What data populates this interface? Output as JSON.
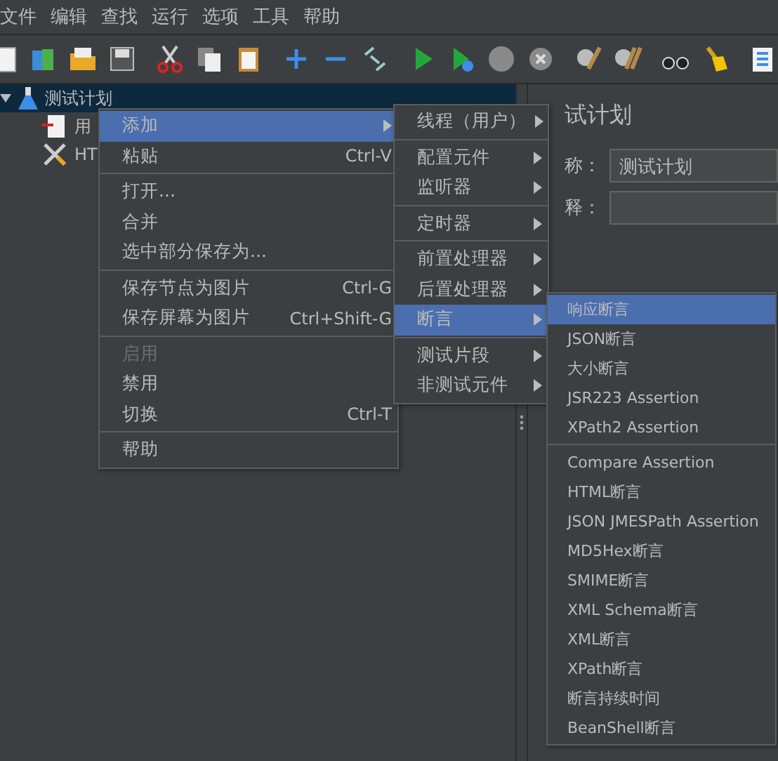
{
  "menubar": [
    "文件",
    "编辑",
    "查找",
    "运行",
    "选项",
    "工具",
    "帮助"
  ],
  "tree": [
    {
      "label": "测试计划",
      "selected": true,
      "expanded": true,
      "children": [
        {
          "label": "用",
          "kind": "thread"
        },
        {
          "label": "HT",
          "kind": "config"
        }
      ]
    }
  ],
  "right_panel": {
    "title": "试计划",
    "fields": [
      {
        "label": "称：",
        "value": "测试计划"
      },
      {
        "label": "释："
      }
    ]
  },
  "context_menu": [
    [
      {
        "label": "添加",
        "submenu": true,
        "selected": true,
        "disabled": false
      },
      {
        "label": "粘贴",
        "shortcut": "Ctrl-V",
        "submenu": false,
        "selected": false,
        "disabled": false
      }
    ],
    [
      {
        "label": "打开...",
        "submenu": false,
        "selected": false,
        "disabled": false
      },
      {
        "label": "合并",
        "submenu": false,
        "selected": false,
        "disabled": false
      },
      {
        "label": "选中部分保存为...",
        "submenu": false,
        "selected": false,
        "disabled": false
      }
    ],
    [
      {
        "label": "保存节点为图片",
        "shortcut": "Ctrl-G",
        "submenu": false,
        "selected": false,
        "disabled": false
      },
      {
        "label": "保存屏幕为图片",
        "shortcut": "Ctrl+Shift-G",
        "submenu": false,
        "selected": false,
        "disabled": false
      }
    ],
    [
      {
        "label": "启用",
        "submenu": false,
        "selected": false,
        "disabled": true
      },
      {
        "label": "禁用",
        "submenu": false,
        "selected": false,
        "disabled": false
      },
      {
        "label": "切换",
        "shortcut": "Ctrl-T",
        "submenu": false,
        "selected": false,
        "disabled": false
      }
    ],
    [
      {
        "label": "帮助",
        "submenu": false,
        "selected": false,
        "disabled": false
      }
    ]
  ],
  "add_submenu": [
    [
      {
        "label": "线程（用户）",
        "submenu": true,
        "selected": false
      }
    ],
    [
      {
        "label": "配置元件",
        "submenu": true,
        "selected": false
      },
      {
        "label": "监听器",
        "submenu": true,
        "selected": false
      }
    ],
    [
      {
        "label": "定时器",
        "submenu": true,
        "selected": false
      }
    ],
    [
      {
        "label": "前置处理器",
        "submenu": true,
        "selected": false
      },
      {
        "label": "后置处理器",
        "submenu": true,
        "selected": false
      },
      {
        "label": "断言",
        "submenu": true,
        "selected": true
      }
    ],
    [
      {
        "label": "测试片段",
        "submenu": true,
        "selected": false
      },
      {
        "label": "非测试元件",
        "submenu": true,
        "selected": false
      }
    ]
  ],
  "assertion_submenu": [
    [
      {
        "label": "响应断言",
        "selected": true
      },
      {
        "label": "JSON断言",
        "selected": false
      },
      {
        "label": "大小断言",
        "selected": false
      },
      {
        "label": "JSR223 Assertion",
        "selected": false
      },
      {
        "label": "XPath2 Assertion",
        "selected": false
      }
    ],
    [
      {
        "label": "Compare Assertion",
        "selected": false
      },
      {
        "label": "HTML断言",
        "selected": false
      },
      {
        "label": "JSON JMESPath Assertion",
        "selected": false
      },
      {
        "label": "MD5Hex断言",
        "selected": false
      },
      {
        "label": "SMIME断言",
        "selected": false
      },
      {
        "label": "XML Schema断言",
        "selected": false
      },
      {
        "label": "XML断言",
        "selected": false
      },
      {
        "label": "XPath断言",
        "selected": false
      },
      {
        "label": "断言持续时间",
        "selected": false
      },
      {
        "label": "BeanShell断言",
        "selected": false
      }
    ]
  ]
}
